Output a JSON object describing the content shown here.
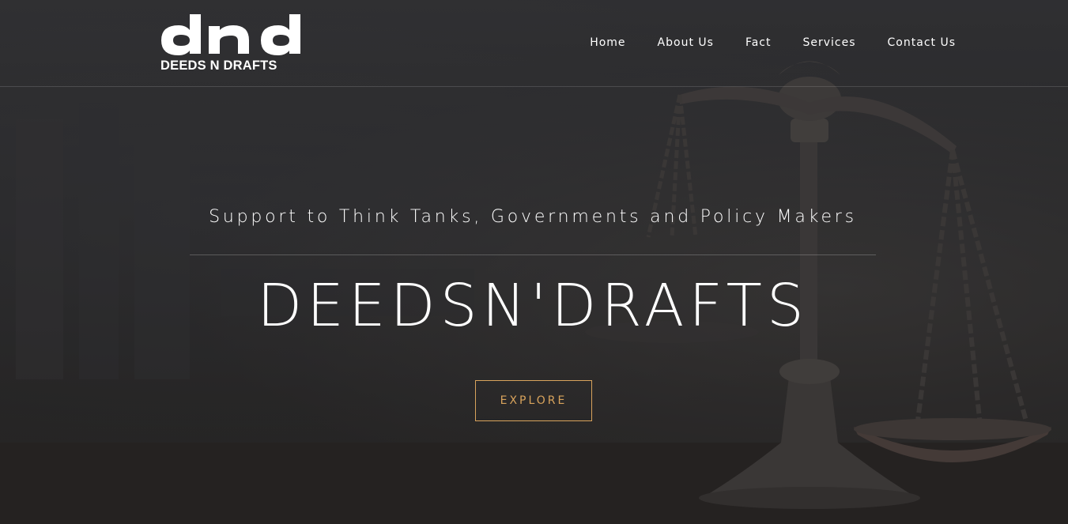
{
  "brand": {
    "logo_mark": "dnd",
    "logo_text": "DEEDS N DRAFTS"
  },
  "nav": {
    "items": [
      {
        "label": "Home"
      },
      {
        "label": "About Us"
      },
      {
        "label": "Fact"
      },
      {
        "label": "Services"
      },
      {
        "label": "Contact Us"
      }
    ]
  },
  "hero": {
    "tagline": "Support to Think Tanks, Governments and Policy Makers",
    "headline": "DEEDSN'DRAFTS",
    "cta_label": "EXPLORE",
    "background_icon": "scales-of-justice-icon"
  },
  "colors": {
    "accent": "#d8a35c",
    "text": "#ffffff",
    "background": "#2f2f31"
  }
}
